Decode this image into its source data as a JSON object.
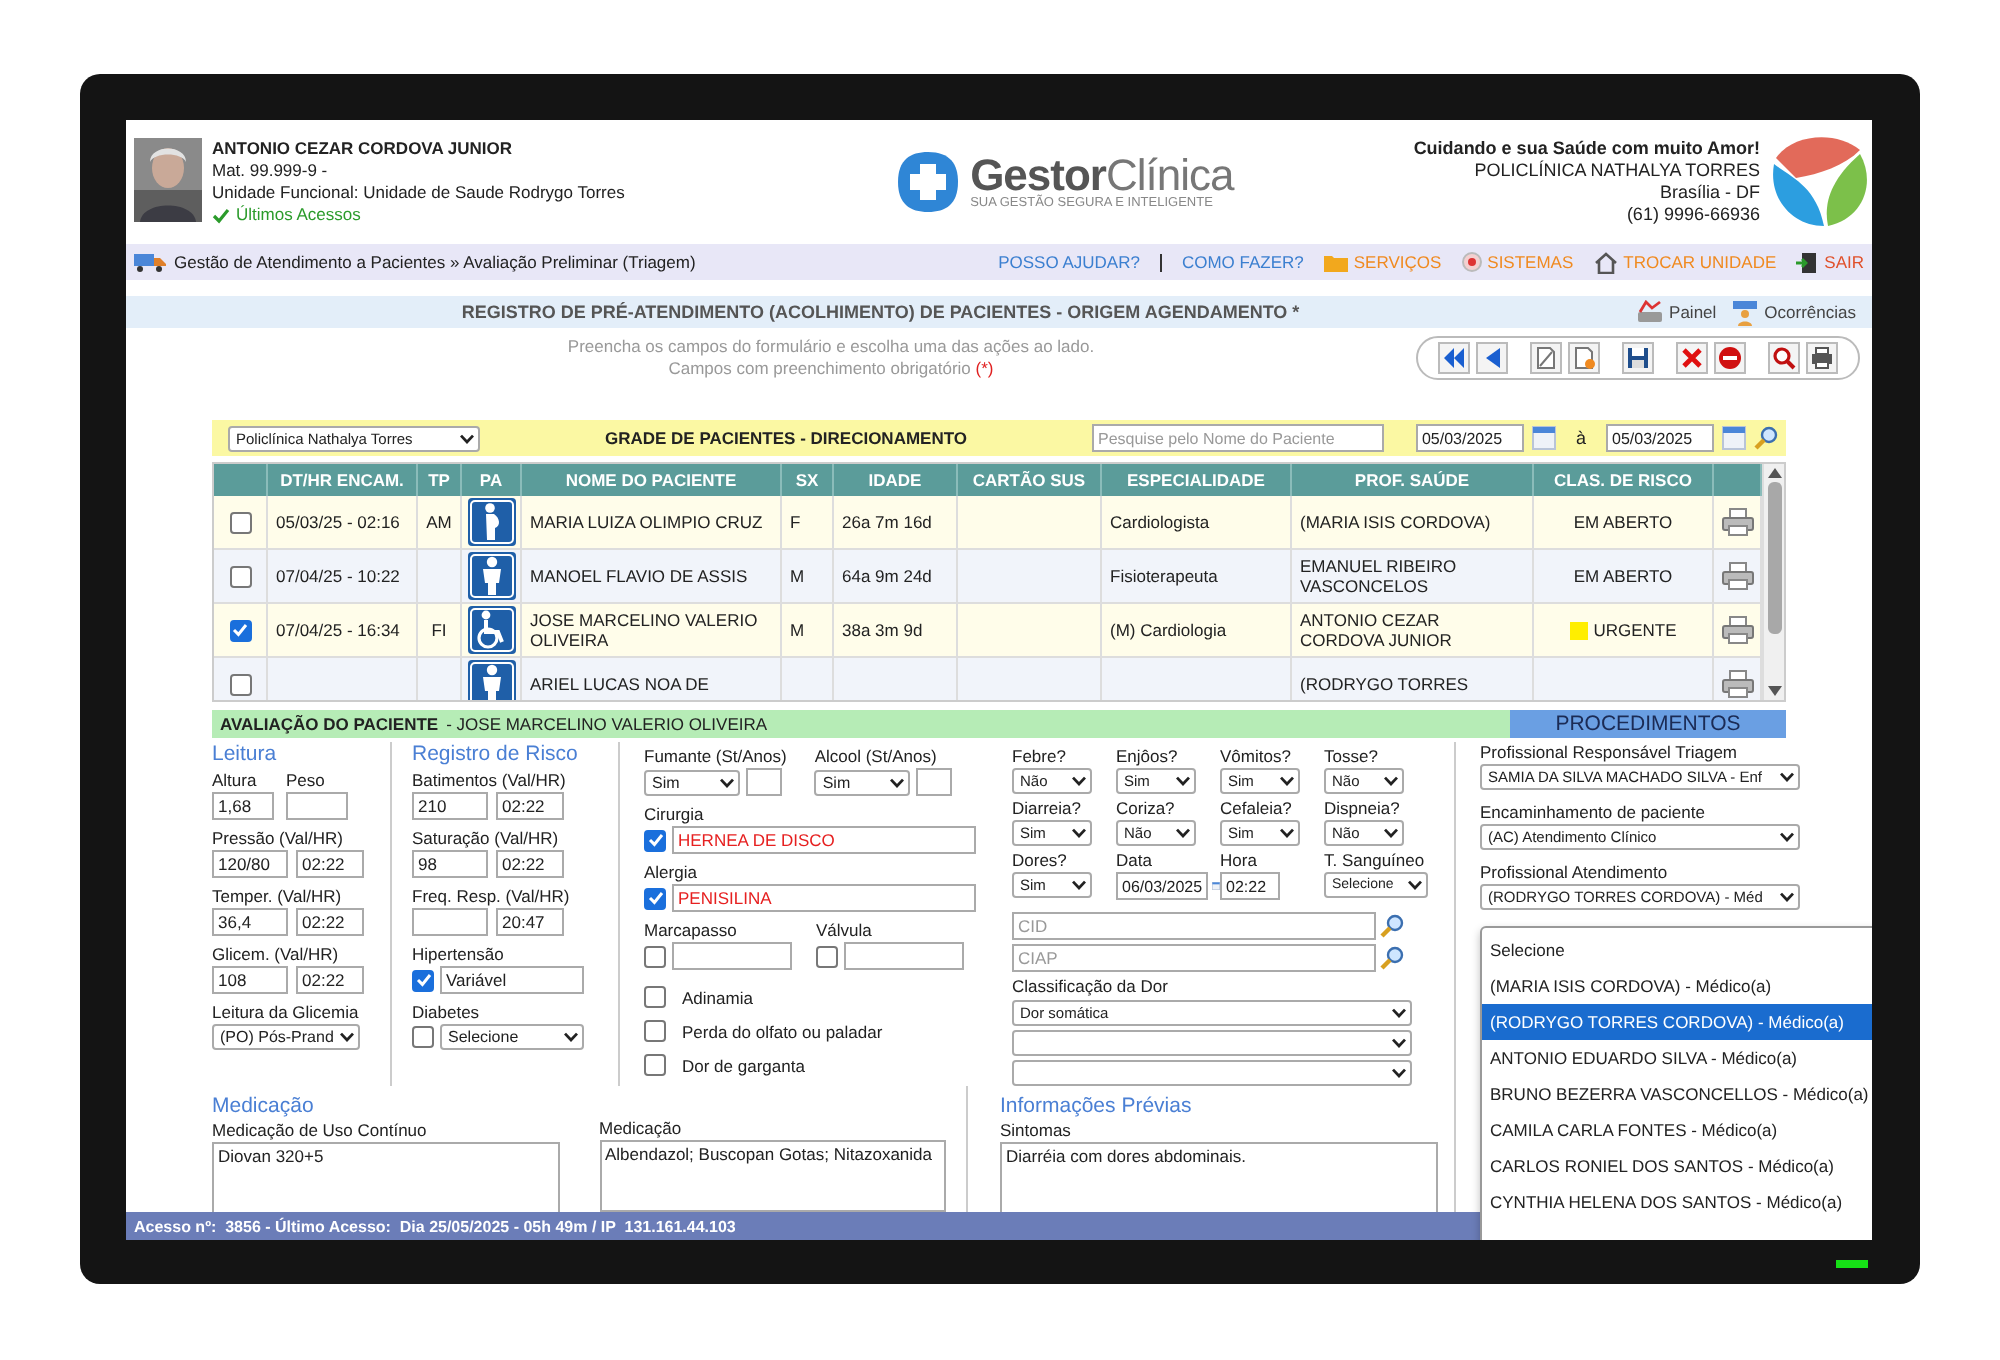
{
  "user": {
    "name": "ANTONIO CEZAR CORDOVA JUNIOR",
    "registration": "Mat. 99.999-9  -",
    "unit": "Unidade Funcional: Unidade de Saude Rodrygo Torres",
    "recent_link": "Últimos Acessos"
  },
  "logo": {
    "brand": "Gestor",
    "brand_light": "Clínica",
    "tagline": "SUA GESTÃO SEGURA E INTELIGENTE"
  },
  "clinic": {
    "slogan": "Cuidando e sua Saúde com muito Amor!",
    "name": "POLICLÍNICA NATHALYA TORRES",
    "city": "Brasília - DF",
    "phone": "(61) 9996-66936"
  },
  "breadcrumb": "Gestão de Atendimento a Pacientes » Avaliação Preliminar (Triagem)",
  "nav_links": [
    {
      "label": "POSSO AJUDAR?",
      "kind": "help"
    },
    {
      "label": "COMO FAZER?",
      "kind": "howto"
    },
    {
      "label": "SERVIÇOS",
      "kind": "services"
    },
    {
      "label": "SISTEMAS",
      "kind": "systems"
    },
    {
      "label": "TROCAR UNIDADE",
      "kind": "switch"
    },
    {
      "label": "SAIR",
      "kind": "exit"
    }
  ],
  "page_title": "REGISTRO DE PRÉ-ATENDIMENTO (ACOLHIMENTO) DE PACIENTES - ORIGEM AGENDAMENTO *",
  "title_links": [
    {
      "label": "Painel",
      "kind": "panel"
    },
    {
      "label": "Ocorrências",
      "kind": "occurrences"
    }
  ],
  "instructions": {
    "text": "Preencha os campos do formulário e escolha uma das ações ao lado.",
    "required_note": "Campos com preenchimento obrigatório",
    "required_mark": "(*)"
  },
  "filter": {
    "unit": "Policlínica Nathalya Torres",
    "title": "GRADE DE PACIENTES - DIRECIONAMENTO",
    "search_placeholder": "Pesquise pelo Nome do Paciente",
    "date_from": "05/03/2025",
    "date_separator": "à",
    "date_to": "05/03/2025"
  },
  "table": {
    "columns": [
      "DT/HR ENCAM.",
      "TP",
      "PA",
      "NOME DO PACIENTE",
      "SX",
      "IDADE",
      "CARTÃO SUS",
      "ESPECIALIDADE",
      "PROF. SAÚDE",
      "CLAS. DE RISCO"
    ],
    "rows": [
      {
        "checked": false,
        "datetime": "05/03/25 - 02:16",
        "type": "AM",
        "kind": "pregnant",
        "name": "MARIA LUIZA OLIMPIO CRUZ",
        "sex": "F",
        "age": "26a 7m 16d",
        "specialty": "Cardiologista",
        "professional": "(MARIA ISIS CORDOVA)",
        "risk": "EM ABERTO"
      },
      {
        "checked": false,
        "datetime": "07/04/25 - 10:22",
        "kind": "person",
        "name": "MANOEL FLAVIO DE ASSIS",
        "sex": "M",
        "age": "64a 9m 24d",
        "specialty": "Fisioterapeuta",
        "professional": "EMANUEL RIBEIRO VASCONCELOS",
        "risk": "EM ABERTO"
      },
      {
        "checked": true,
        "datetime": "07/04/25 - 16:34",
        "type": "FI",
        "kind": "wheelchair",
        "name": "JOSE MARCELINO VALERIO OLIVEIRA",
        "sex": "M",
        "age": "38a 3m 9d",
        "specialty": "(M) Cardiologia",
        "professional": "ANTONIO CEZAR CORDOVA JUNIOR",
        "risk": "URGENTE",
        "color": "#ffee00"
      },
      {
        "checked": false,
        "kind": "person",
        "name": "ARIEL LUCAS NOA DE",
        "professional": "(RODRYGO TORRES"
      }
    ]
  },
  "evaluation": {
    "title": "AVALIAÇÃO DO PACIENTE",
    "patient": "- JOSE MARCELINO VALERIO OLIVEIRA",
    "tab": "PROCEDIMENTOS"
  },
  "reading": {
    "heading": "Leitura",
    "fields": [
      {
        "kind": "double",
        "items": [
          {
            "label": "Altura",
            "value": "1,68"
          },
          {
            "label": "Peso"
          }
        ]
      },
      {
        "kind": "pair",
        "label": "Pressão (Val/HR)",
        "value": "120/80",
        "time": "02:22"
      },
      {
        "kind": "pair",
        "label": "Temper. (Val/HR)",
        "value": "36,4",
        "time": "02:22"
      },
      {
        "kind": "pair",
        "label": "Glicem. (Val/HR)",
        "value": "108",
        "time": "02:22"
      },
      {
        "kind": "select",
        "label": "Leitura da Glicemia",
        "value": "(PO) Pós-Prand"
      }
    ]
  },
  "risk": {
    "heading": "Registro de Risco",
    "fields": [
      {
        "kind": "pair",
        "label": "Batimentos (Val/HR)",
        "value": "210",
        "time": "02:22"
      },
      {
        "kind": "pair",
        "label": "Saturação (Val/HR)",
        "value": "98",
        "time": "02:22"
      },
      {
        "kind": "pair",
        "label": "Freq. Resp. (Val/HR)",
        "time": "20:47"
      },
      {
        "kind": "check_input",
        "label": "Hipertensão",
        "checked": true,
        "value": "Variável"
      },
      {
        "kind": "check_select",
        "label": "Diabetes",
        "checked": false,
        "value": "Selecione"
      }
    ]
  },
  "history": {
    "habits": [
      {
        "label": "Fumante (St/Anos)",
        "value": "Sim"
      },
      {
        "label": "Alcool (St/Anos)",
        "value": "Sim"
      }
    ],
    "conditions": [
      {
        "label": "Cirurgia",
        "checked": true,
        "value": "HERNEA DE DISCO"
      },
      {
        "label": "Alergia",
        "checked": true,
        "value": "PENISILINA"
      }
    ],
    "devices": [
      {
        "label": "Marcapasso",
        "checked": false
      },
      {
        "label": "Válvula",
        "checked": false
      }
    ],
    "checks": [
      {
        "label": "Adinamia",
        "checked": false
      },
      {
        "label": "Perda do olfato ou paladar",
        "checked": false
      },
      {
        "label": "Dor de garganta",
        "checked": false
      }
    ]
  },
  "symptoms": {
    "items": [
      {
        "label": "Febre?",
        "value": "Não"
      },
      {
        "label": "Enjôos?",
        "value": "Sim"
      },
      {
        "label": "Vômitos?",
        "value": "Sim"
      },
      {
        "label": "Tosse?",
        "value": "Não"
      },
      {
        "label": "Diarreia?",
        "value": "Sim"
      },
      {
        "label": "Coriza?",
        "value": "Não"
      },
      {
        "label": "Cefaleia?",
        "value": "Sim"
      },
      {
        "label": "Dispneia?",
        "value": "Não"
      }
    ],
    "pain": {
      "label": "Dores?",
      "value": "Sim"
    },
    "date": {
      "label": "Data",
      "value": "06/03/2025"
    },
    "time": {
      "label": "Hora",
      "value": "02:22"
    },
    "blood": {
      "label": "T. Sanguíneo",
      "value": "Selecione"
    },
    "cid_placeholder": "CID",
    "ciap_placeholder": "CIAP",
    "pain_class": {
      "label": "Classificação da Dor",
      "value": "Dor somática"
    }
  },
  "assignment": {
    "fields": [
      {
        "label": "Profissional Responsável Triagem",
        "value": "SAMIA DA SILVA MACHADO SILVA - Enf"
      },
      {
        "label": "Encaminhamento de paciente",
        "value": "(AC) Atendimento Clínico"
      },
      {
        "label": "Profissional Atendimento",
        "value": "(RODRYGO TORRES CORDOVA) - Méd"
      }
    ],
    "options": [
      {
        "label": "Selecione",
        "selected": false
      },
      {
        "label": "(MARIA ISIS CORDOVA) - Médico(a)",
        "selected": false
      },
      {
        "label": "(RODRYGO TORRES CORDOVA) - Médico(a)",
        "selected": true
      },
      {
        "label": "ANTONIO EDUARDO SILVA - Médico(a)",
        "selected": false
      },
      {
        "label": "BRUNO BEZERRA VASCONCELLOS - Médico(a)",
        "selected": false
      },
      {
        "label": "CAMILA CARLA FONTES - Médico(a)",
        "selected": false
      },
      {
        "label": "CARLOS RONIEL DOS SANTOS - Médico(a)",
        "selected": false
      },
      {
        "label": "CYNTHIA HELENA DOS SANTOS - Médico(a)",
        "selected": false
      }
    ]
  },
  "medication": {
    "heading": "Medicação",
    "continuous": {
      "label": "Medicação de Uso Contínuo",
      "value": "Diovan 320+5"
    },
    "current": {
      "label": "Medicação",
      "value": "Albendazol; Buscopan Gotas; Nitazoxanida"
    }
  },
  "previous_info": {
    "heading": "Informações Prévias",
    "label": "Sintomas",
    "value": "Diarréia com dores abdominais."
  },
  "status_bar": "Acesso nº:  3856 - Último Acesso:  Dia 25/05/2025 - 05h 49m / IP  131.161.44.103"
}
